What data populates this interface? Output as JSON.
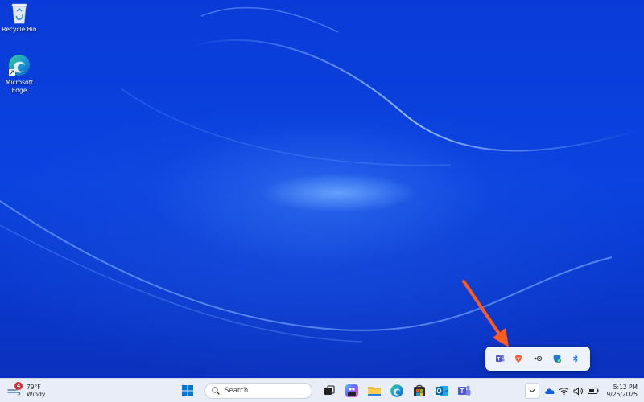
{
  "desktop": {
    "icons": [
      {
        "label": "Recycle Bin",
        "icon": "recycle-bin-icon"
      },
      {
        "label": "Microsoft Edge",
        "label_line1": "Microsoft",
        "label_line2": "Edge",
        "icon": "edge-icon"
      }
    ]
  },
  "annotation": {
    "arrow_color": "#ff5a1f",
    "points_to": "system-tray-overflow-popup"
  },
  "tray_overflow": {
    "icons": [
      {
        "icon": "teams-icon"
      },
      {
        "icon": "brave-icon"
      },
      {
        "icon": "meet-now-icon"
      },
      {
        "icon": "defender-icon"
      },
      {
        "icon": "bluetooth-icon"
      }
    ]
  },
  "taskbar": {
    "weather": {
      "temperature": "79°F",
      "condition": "Windy",
      "badge_count": "4"
    },
    "search": {
      "placeholder": "Search"
    },
    "pinned_apps": [
      {
        "icon": "start-icon"
      },
      {
        "icon": "task-view-icon"
      },
      {
        "icon": "copilot-icon"
      },
      {
        "icon": "file-explorer-icon"
      },
      {
        "icon": "edge-icon"
      },
      {
        "icon": "microsoft-store-icon"
      },
      {
        "icon": "outlook-icon"
      },
      {
        "icon": "teams-icon"
      }
    ],
    "system_tray": {
      "icons": [
        "chevron-up-icon",
        "onedrive-icon",
        "wifi-icon",
        "volume-icon",
        "battery-icon"
      ]
    },
    "clock": {
      "time": "5:12 PM",
      "date": "9/25/2025"
    }
  },
  "colors": {
    "wallpaper": "#0b43e0",
    "taskbar": "#e8edf7",
    "arrow": "#ff5a1f",
    "accent": "#0067c0"
  }
}
